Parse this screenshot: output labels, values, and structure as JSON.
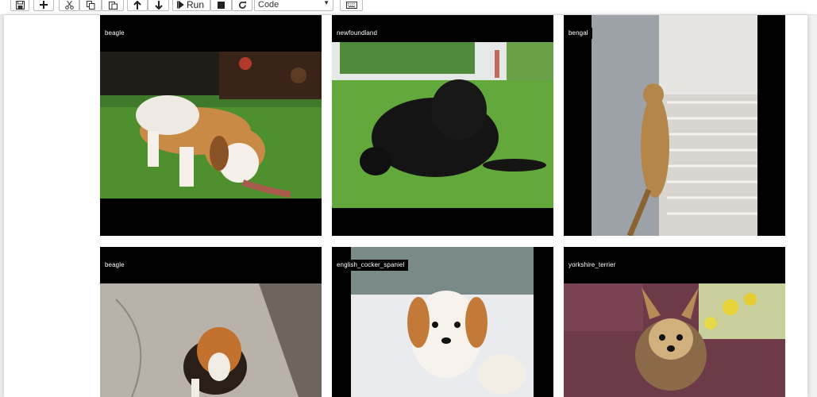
{
  "toolbar": {
    "run_label": "Run",
    "cell_type": "Code"
  },
  "icons": [
    "save-icon",
    "plus-icon",
    "scissors-icon",
    "copy-icon",
    "paste-icon",
    "arrow-up-icon",
    "arrow-down-icon",
    "play-icon",
    "stop-icon",
    "restart-icon",
    "keyboard-icon"
  ],
  "grid": {
    "labels": [
      "beagle",
      "newfoundland",
      "bengal",
      "beagle",
      "english_cocker_spaniel",
      "yorkshire_terrier"
    ]
  },
  "colors": {
    "cell_background": "#000000",
    "label_text": "#ffffff",
    "grass": "#4e8f2e",
    "page_background": "#ffffff"
  }
}
